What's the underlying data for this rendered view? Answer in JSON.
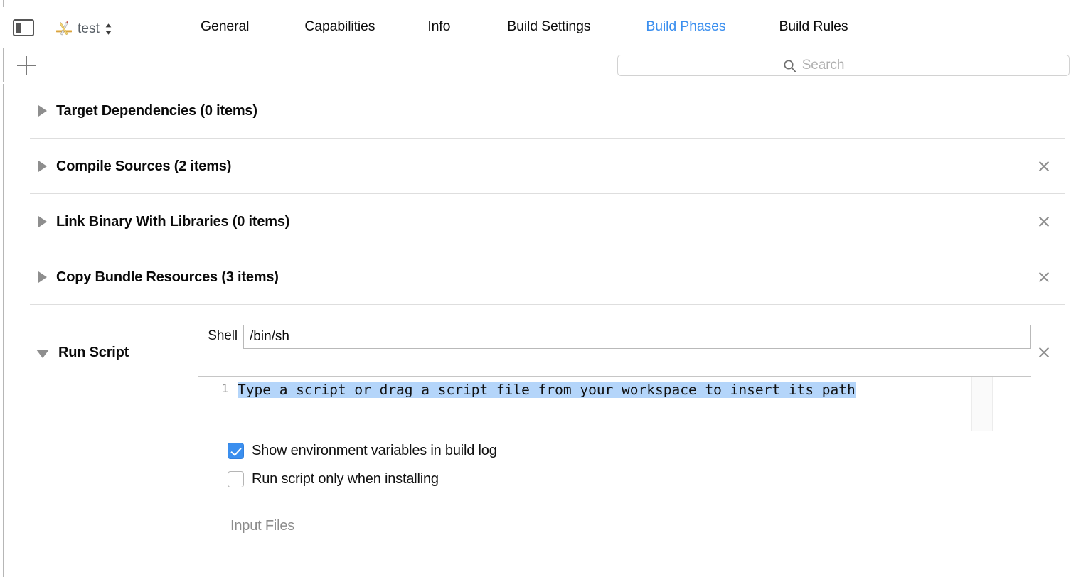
{
  "window": {
    "sidebar_toggle_icon": "sidebar-toggle-icon",
    "project_icon": "xcode-project-icon",
    "project_name": "test",
    "project_chevron_icon": "chevron-up-down-icon"
  },
  "tabs": [
    {
      "label": "General",
      "selected": false
    },
    {
      "label": "Capabilities",
      "selected": false
    },
    {
      "label": "Info",
      "selected": false
    },
    {
      "label": "Build Settings",
      "selected": false
    },
    {
      "label": "Build Phases",
      "selected": true
    },
    {
      "label": "Build Rules",
      "selected": false
    }
  ],
  "toolbar": {
    "add_phase_icon": "plus-icon",
    "search_icon": "search-icon",
    "search_placeholder": "Search",
    "search_value": ""
  },
  "phases": [
    {
      "title": "Target Dependencies (0 items)",
      "expanded": false,
      "removable": false,
      "disclosure_icon": "triangle-right-icon"
    },
    {
      "title": "Compile Sources (2 items)",
      "expanded": false,
      "removable": true,
      "disclosure_icon": "triangle-right-icon"
    },
    {
      "title": "Link Binary With Libraries (0 items)",
      "expanded": false,
      "removable": true,
      "disclosure_icon": "triangle-right-icon"
    },
    {
      "title": "Copy Bundle Resources (3 items)",
      "expanded": false,
      "removable": true,
      "disclosure_icon": "triangle-right-icon"
    },
    {
      "title": "Run Script",
      "expanded": true,
      "removable": true,
      "disclosure_icon": "triangle-down-icon"
    }
  ],
  "run_script": {
    "shell_label": "Shell",
    "shell_value": "/bin/sh",
    "editor": {
      "line_number": "1",
      "placeholder_text": "Type a script or drag a script file from your workspace to insert its path",
      "text_selected": true
    },
    "checkboxes": [
      {
        "label": "Show environment variables in build log",
        "checked": true
      },
      {
        "label": "Run script only when installing",
        "checked": false
      }
    ],
    "input_files_label": "Input Files",
    "remove_icon": "close-x-icon"
  },
  "colors": {
    "accent_blue": "#3b8fef",
    "selection_blue": "#b4d5fa",
    "separator": "#dedede",
    "muted_text": "#8c8c8c"
  }
}
